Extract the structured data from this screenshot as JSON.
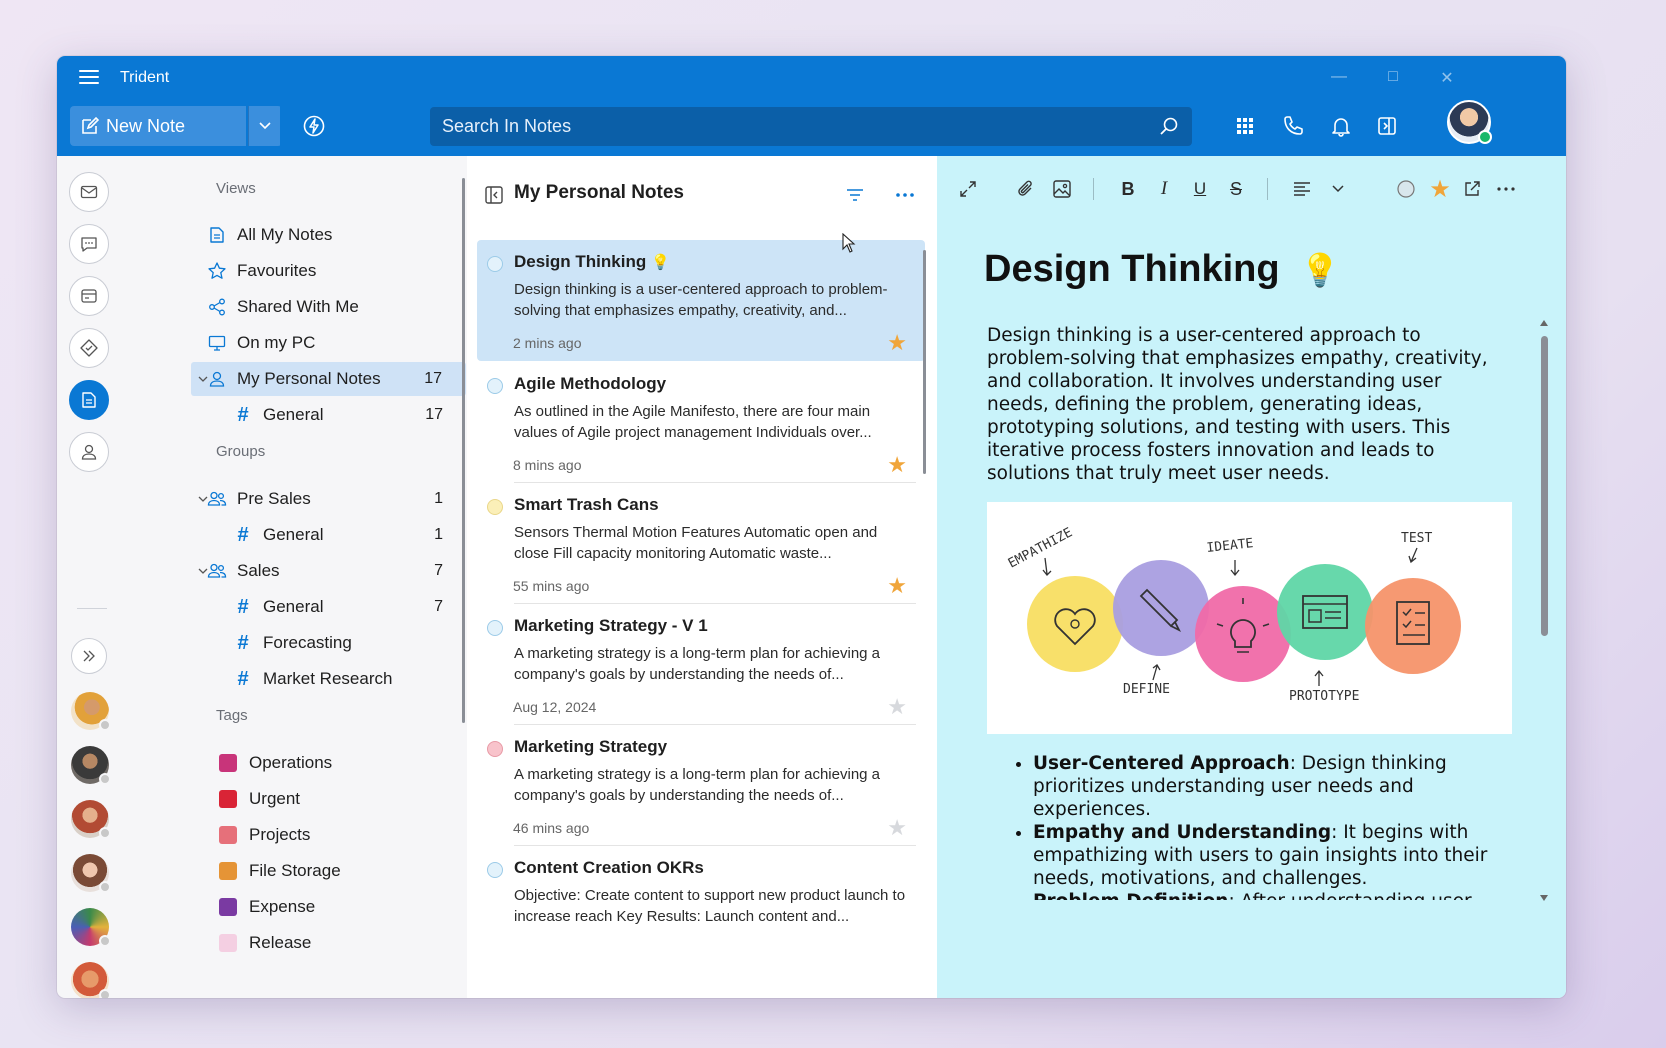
{
  "app": {
    "title": "Trident"
  },
  "toolbar": {
    "new_note_label": "New Note",
    "search_placeholder": "Search In Notes"
  },
  "nav": {
    "views_header": "Views",
    "views": [
      {
        "label": "All My Notes"
      },
      {
        "label": "Favourites"
      },
      {
        "label": "Shared With Me"
      },
      {
        "label": "On my PC"
      },
      {
        "label": "My Personal Notes",
        "count": "17"
      },
      {
        "label": "General",
        "count": "17"
      }
    ],
    "groups_header": "Groups",
    "groups": [
      {
        "label": "Pre Sales",
        "count": "1"
      },
      {
        "label": "General",
        "count": "1"
      },
      {
        "label": "Sales",
        "count": "7"
      },
      {
        "label": "General",
        "count": "7"
      },
      {
        "label": "Forecasting"
      },
      {
        "label": "Market Research"
      }
    ],
    "tags_header": "Tags",
    "tags": [
      {
        "label": "Operations",
        "color": "#c8347a"
      },
      {
        "label": "Urgent",
        "color": "#d92436"
      },
      {
        "label": "Projects",
        "color": "#e6707a"
      },
      {
        "label": "File Storage",
        "color": "#e59436"
      },
      {
        "label": "Expense",
        "color": "#7a3aa2"
      },
      {
        "label": "Release",
        "color": "#f4cfe2"
      }
    ]
  },
  "list": {
    "title": "My Personal Notes",
    "notes": [
      {
        "title": "Design Thinking",
        "snippet": "Design thinking is a user-centered approach to problem-solving that emphasizes empathy, creativity, and...",
        "time": "2 mins ago",
        "starred": true,
        "circle": "#e3f2fb"
      },
      {
        "title": "Agile Methodology",
        "snippet": "As outlined in the Agile Manifesto, there are four main values of Agile project management Individuals over...",
        "time": "8 mins ago",
        "starred": true,
        "circle": "#e3f2fb"
      },
      {
        "title": "Smart Trash Cans",
        "snippet": "Sensors Thermal Motion Features Automatic open and close Fill capacity monitoring Automatic waste...",
        "time": "55 mins ago",
        "starred": true,
        "circle": "#fbefb8"
      },
      {
        "title": "Marketing Strategy - V 1",
        "snippet": "A marketing strategy is a long-term plan for achieving a company's goals by understanding the needs of...",
        "time": "Aug 12, 2024",
        "starred": false,
        "circle": "#e3f2fb"
      },
      {
        "title": "Marketing Strategy",
        "snippet": "A marketing strategy is a long-term plan for achieving a company's goals by understanding the needs of...",
        "time": "46 mins ago",
        "starred": false,
        "circle": "#f8c3cb"
      },
      {
        "title": "Content Creation OKRs",
        "snippet": "Objective: Create content to support new product launch to increase reach Key Results: Launch content and...",
        "time": "",
        "starred": false,
        "circle": "#e3f2fb"
      }
    ]
  },
  "editor": {
    "title": "Design Thinking",
    "body": "Design thinking is a user-centered approach to problem-solving that emphasizes empathy, creativity, and collaboration. It involves understanding user needs, defining the problem, generating ideas, prototyping solutions, and testing with users. This iterative process fosters innovation and leads to solutions that truly meet user needs.",
    "image_labels": {
      "empathize": "EMPATHIZE",
      "define": "DEFINE",
      "ideate": "IDEATE",
      "prototype": "PROTOTYPE",
      "test": "TEST"
    },
    "bullets": [
      {
        "term": "User-Centered Approach",
        "text": ": Design thinking prioritizes understanding user needs and experiences."
      },
      {
        "term": "Empathy and Understanding",
        "text": ": It begins with empathizing with users to gain insights into their needs, motivations, and challenges."
      },
      {
        "term": "Problem Definition",
        "text": ": After understanding user"
      }
    ]
  },
  "colors": {
    "accent": "#0a78d4",
    "star": "#f0a53a",
    "editor_bg": "#c9f3fa",
    "selected": "#cde4f7"
  }
}
